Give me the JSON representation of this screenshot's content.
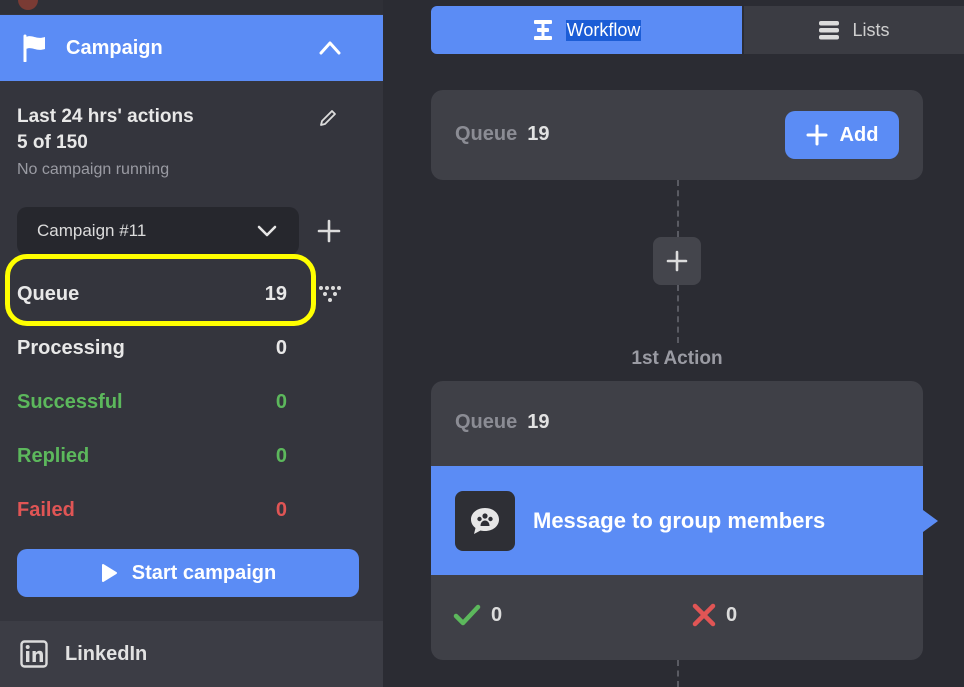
{
  "sidebar": {
    "campaign_title": "Campaign",
    "stats": {
      "title": "Last 24 hrs' actions",
      "count": "5 of 150",
      "status": "No campaign running"
    },
    "campaign_select": "Campaign #11",
    "rows": [
      {
        "label": "Queue",
        "value": "19",
        "color": "#e8e8e8"
      },
      {
        "label": "Processing",
        "value": "0",
        "color": "#e8e8e8"
      },
      {
        "label": "Successful",
        "value": "0",
        "color": "#5cb85c"
      },
      {
        "label": "Replied",
        "value": "0",
        "color": "#5cb85c"
      },
      {
        "label": "Failed",
        "value": "0",
        "color": "#e05555"
      }
    ],
    "start_button": "Start campaign",
    "linkedin_label": "LinkedIn"
  },
  "tabs": {
    "workflow": "Workflow",
    "lists": "Lists"
  },
  "workflow": {
    "queue_label": "Queue",
    "queue_value": "19",
    "add_button": "Add",
    "action_label": "1st Action",
    "action_queue_label": "Queue",
    "action_queue_value": "19",
    "action_title": "Message to group members",
    "success_count": "0",
    "fail_count": "0"
  },
  "colors": {
    "accent": "#5b8cf5",
    "highlight": "#ffff00",
    "success": "#5cb85c",
    "fail": "#e05555"
  }
}
